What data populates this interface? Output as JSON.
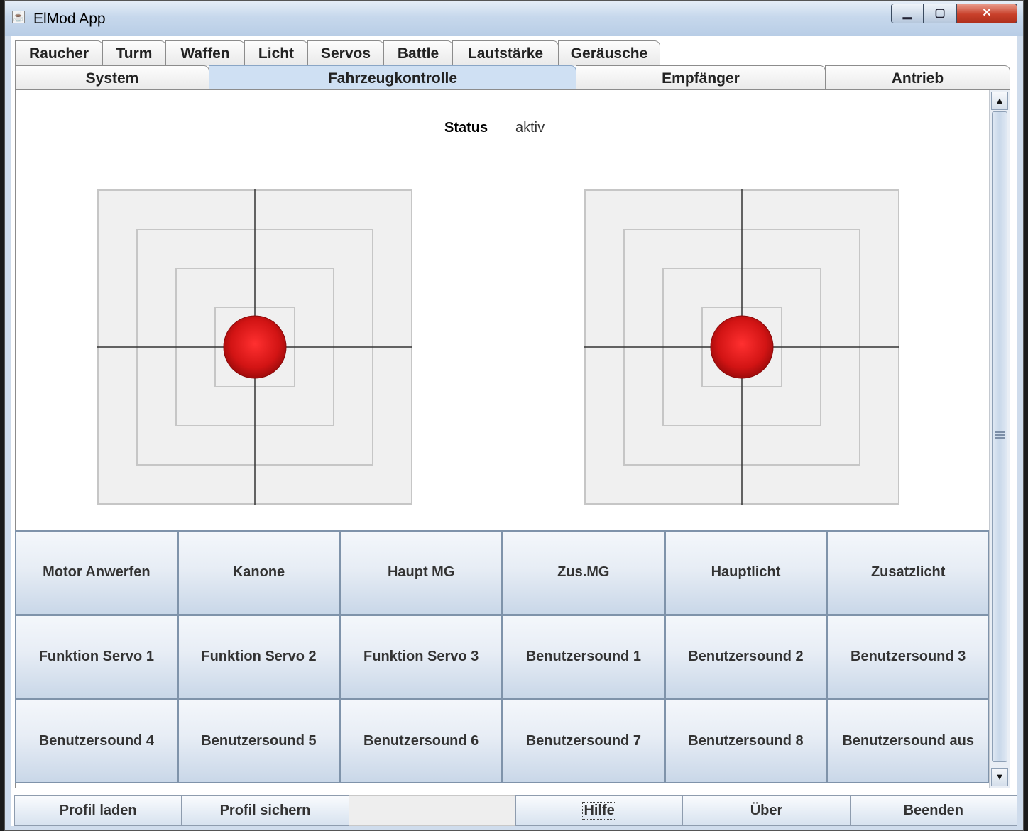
{
  "window": {
    "title": "ElMod App"
  },
  "tabs": {
    "row1": [
      "Raucher",
      "Turm",
      "Waffen",
      "Licht",
      "Servos",
      "Battle",
      "Lautstärke",
      "Geräusche"
    ],
    "row2": [
      "System",
      "Fahrzeugkontrolle",
      "Empfänger",
      "Antrieb"
    ],
    "selected": "Fahrzeugkontrolle"
  },
  "status": {
    "label": "Status",
    "value": "aktiv"
  },
  "joysticks": [
    {
      "name": "left",
      "x": 0,
      "y": 0
    },
    {
      "name": "right",
      "x": 0,
      "y": 0
    }
  ],
  "buttons": [
    [
      "Motor Anwerfen",
      "Kanone",
      "Haupt MG",
      "Zus.MG",
      "Hauptlicht",
      "Zusatzlicht"
    ],
    [
      "Funktion Servo 1",
      "Funktion Servo 2",
      "Funktion Servo 3",
      "Benutzersound 1",
      "Benutzersound 2",
      "Benutzersound 3"
    ],
    [
      "Benutzersound 4",
      "Benutzersound 5",
      "Benutzersound 6",
      "Benutzersound 7",
      "Benutzersound 8",
      "Benutzersound aus"
    ]
  ],
  "bottom": {
    "profil_laden": "Profil laden",
    "profil_sichern": "Profil sichern",
    "hilfe": "Hilfe",
    "ueber": "Über",
    "beenden": "Beenden"
  },
  "colors": {
    "knob": "#e01a1a",
    "selected_tab": "#cfe0f3",
    "button_border": "#7f93aa"
  }
}
